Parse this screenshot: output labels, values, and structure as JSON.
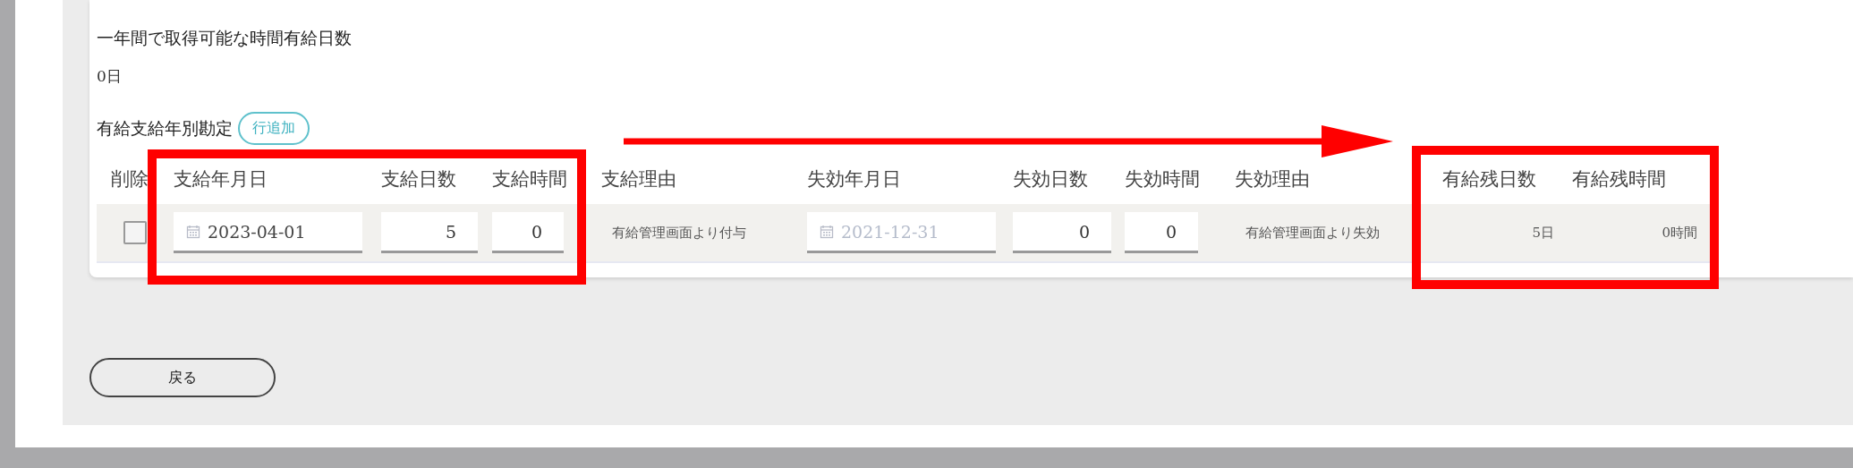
{
  "hourly_leave_days": {
    "label": "一年間で取得可能な時間有給日数",
    "value": "0日"
  },
  "grants": {
    "label": "有給支給年別勘定",
    "add_button": "行追加",
    "columns": [
      "削除",
      "支給年月日",
      "支給日数",
      "支給時間",
      "支給理由",
      "失効年月日",
      "失効日数",
      "失効時間",
      "失効理由",
      "有給残日数",
      "有給残時間"
    ],
    "rows": [
      {
        "checked": false,
        "grant_date": "2023-04-01",
        "grant_days": "5",
        "grant_hours": "0",
        "grant_reason": "有給管理画面より付与",
        "expiry_date": {
          "placeholder": "2021-12-31"
        },
        "expiry_days": "0",
        "expiry_hours": "0",
        "expiry_reason": "有給管理画面より失効",
        "remaining_days": "5日",
        "remaining_hours": "0時間"
      }
    ]
  },
  "back_button": "戻る"
}
